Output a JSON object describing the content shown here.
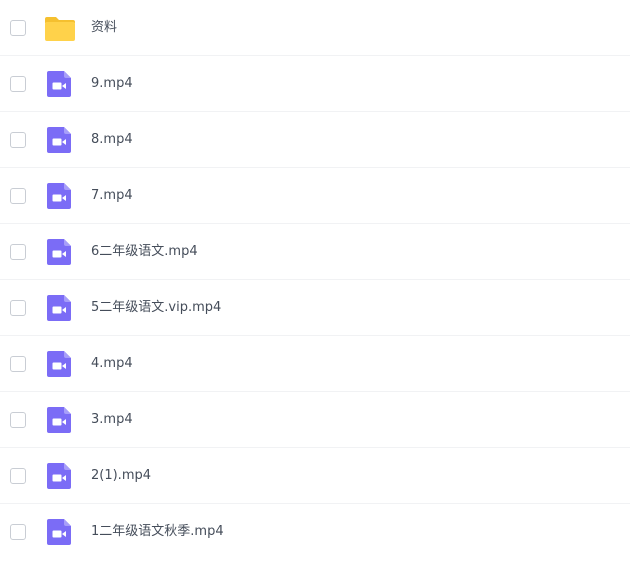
{
  "files": [
    {
      "name": "资料",
      "icon": "folder-icon"
    },
    {
      "name": "9.mp4",
      "icon": "video-file-icon"
    },
    {
      "name": "8.mp4",
      "icon": "video-file-icon"
    },
    {
      "name": "7.mp4",
      "icon": "video-file-icon"
    },
    {
      "name": "6二年级语文.mp4",
      "icon": "video-file-icon"
    },
    {
      "name": "5二年级语文.vip.mp4",
      "icon": "video-file-icon"
    },
    {
      "name": "4.mp4",
      "icon": "video-file-icon"
    },
    {
      "name": "3.mp4",
      "icon": "video-file-icon"
    },
    {
      "name": "2(1).mp4",
      "icon": "video-file-icon"
    },
    {
      "name": "1二年级语文秋季.mp4",
      "icon": "video-file-icon"
    }
  ],
  "colors": {
    "folder": "#ffd24a",
    "folder_tab": "#f5c02f",
    "video": "#7b6cf6",
    "text": "#454d5a",
    "divider": "#f1f2f4",
    "checkbox_border": "#c9cdd4"
  }
}
